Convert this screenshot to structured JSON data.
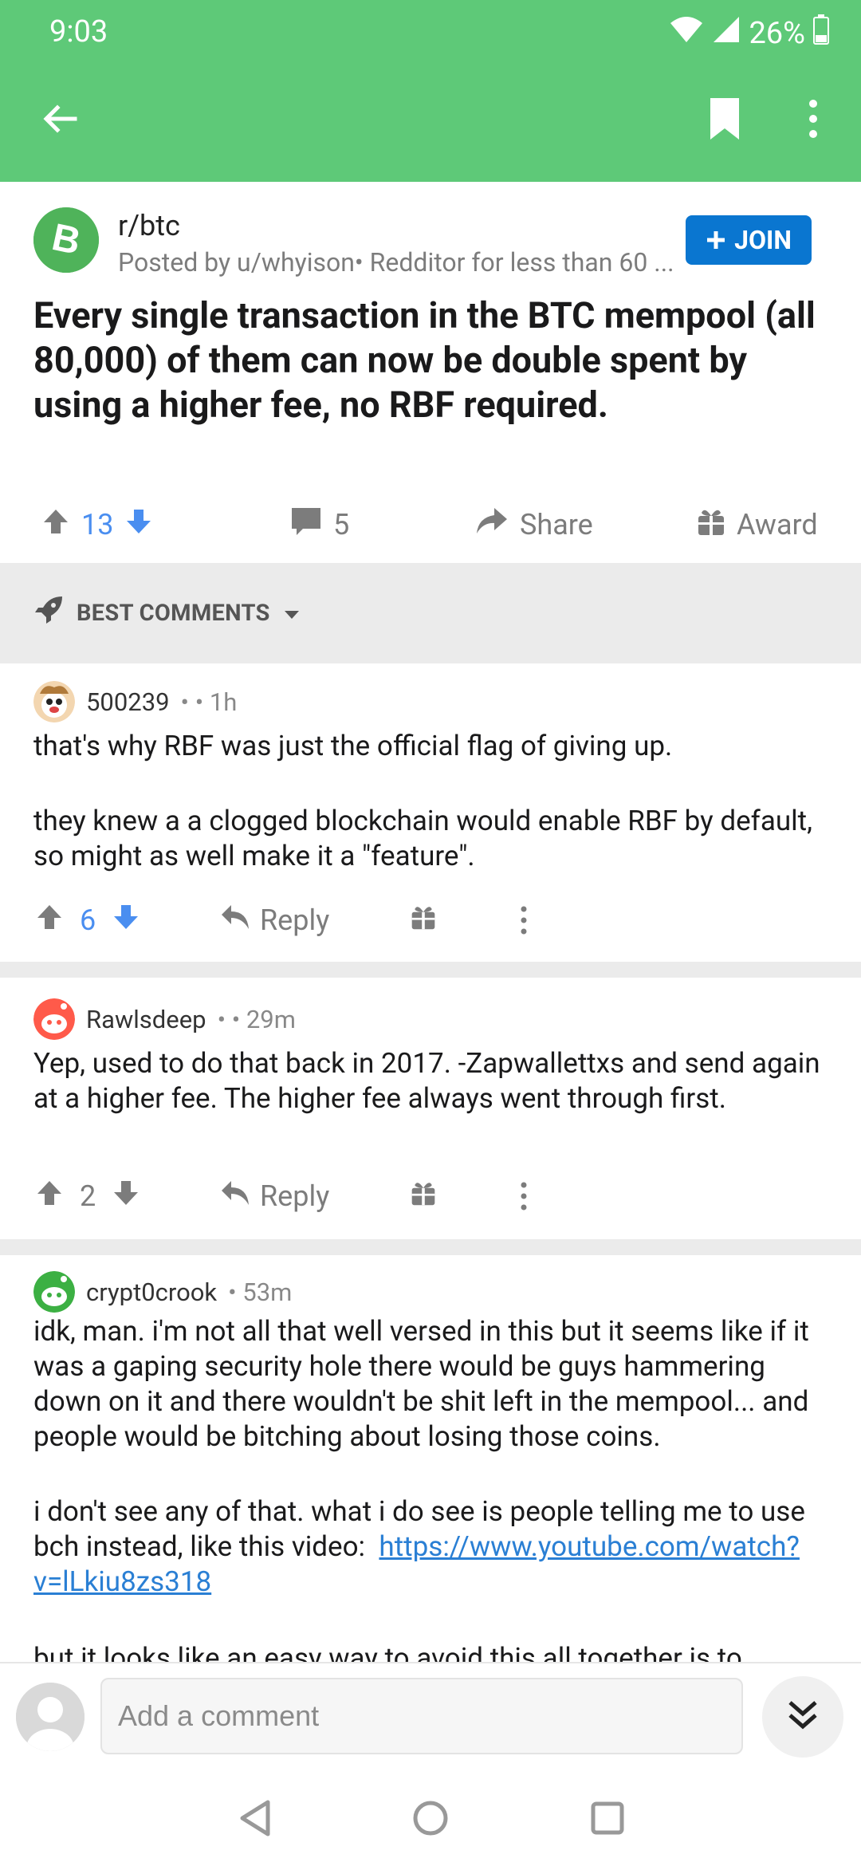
{
  "status": {
    "time": "9:03",
    "battery": "26%"
  },
  "post": {
    "subreddit": "r/btc",
    "posted_by": "Posted by u/whyison• Redditor for less than 60 ...",
    "join_label": "JOIN",
    "title": "Every single transaction in the BTC mempool (all 80,000) of them can now be double spent by using a higher fee, no RBF required.",
    "score": "13",
    "comments_count": "5",
    "share_label": "Share",
    "award_label": "Award"
  },
  "sort": {
    "label": "BEST COMMENTS"
  },
  "comments": [
    {
      "author": "500239",
      "meta": "• • 1h",
      "paragraphs": [
        "that's why RBF was just the official flag of giving up.",
        "they knew a a clogged blockchain would enable RBF by default, so might as well make it a \"feature\"."
      ],
      "score": "6",
      "reply_label": "Reply"
    },
    {
      "author": "Rawlsdeep",
      "meta": "• • 29m",
      "paragraphs": [
        "Yep, used to do that back in 2017. -Zapwallettxs and send again at a higher fee. The higher fee always went through first."
      ],
      "score": "2",
      "reply_label": "Reply"
    },
    {
      "author": "crypt0crook",
      "meta": "• 53m",
      "paragraphs": [
        "idk, man. i'm not all that well versed in this but it seems like if it was a gaping security hole there would be guys hammering down on it and there wouldn't be shit left in the mempool... and people would be bitching about losing those coins.",
        "i don't see any of that. what i do see is people telling me to use bch instead, like this video:"
      ],
      "link_text": "https://www.youtube.com/watch?v=lLkiu8zs318",
      "cutoff_text": "but it looks like an easy way to avoid this all together is to"
    }
  ],
  "composer": {
    "placeholder": "Add a comment"
  },
  "colors": {
    "toolbar": "#5ec978",
    "join": "#0a76d0",
    "upvote_active": "#4a8ef0",
    "link": "#2a7fd4"
  }
}
